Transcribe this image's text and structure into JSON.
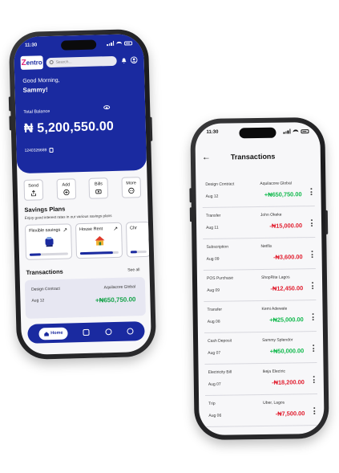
{
  "home": {
    "status_time": "11:30",
    "logo_initial": "Z",
    "logo_rest": "entro",
    "search_placeholder": "Search...",
    "greeting": "Good Morning,",
    "user_name": "Sammy!",
    "total_balance_label": "Total Balance",
    "balance": "₦ 5,200,550.00",
    "account_number": "1240326689",
    "actions": [
      {
        "label": "Send",
        "icon": "share-icon"
      },
      {
        "label": "Add",
        "icon": "plus-circle-icon"
      },
      {
        "label": "Bills",
        "icon": "bill-icon"
      },
      {
        "label": "More",
        "icon": "more-icon"
      }
    ],
    "savings_title": "Savings Plans",
    "savings_subtitle": "Enjoy good interest rates in our various savings plans",
    "plans": [
      {
        "label": "Flexible savings",
        "progress": 0.3
      },
      {
        "label": "House Rent",
        "progress": 0.85
      },
      {
        "label": "Chr",
        "progress": 0.4
      }
    ],
    "transactions_title": "Transactions",
    "see_all": "See all",
    "latest_tx": {
      "desc": "Design Contract",
      "date": "Aug 12",
      "counterparty": "Aquilacore Global",
      "amount": "+₦650,750.00"
    },
    "nav": {
      "home_label": "Home"
    }
  },
  "transactions": {
    "status_time": "11:30",
    "title": "Transactions",
    "items": [
      {
        "desc": "Design Contract",
        "date": "Aug 12",
        "counterparty": "Aquilacore Global",
        "amount": "+₦650,750.00",
        "kind": "credit"
      },
      {
        "desc": "Transfer",
        "date": "Aug 11",
        "counterparty": "John Okeke",
        "amount": "-₦15,000.00",
        "kind": "debit"
      },
      {
        "desc": "Subscription",
        "date": "Aug 09",
        "counterparty": "Netflix",
        "amount": "-₦3,600.00",
        "kind": "debit"
      },
      {
        "desc": "POS Purchase",
        "date": "Aug 09",
        "counterparty": "ShopRite Lagos",
        "amount": "-₦12,450.00",
        "kind": "debit"
      },
      {
        "desc": "Transfer",
        "date": "Aug 08",
        "counterparty": "Kemi Adewale",
        "amount": "+₦25,000.00",
        "kind": "credit"
      },
      {
        "desc": "Cash Deposit",
        "date": "Aug 07",
        "counterparty": "Sammy Splendor",
        "amount": "+₦50,000.00",
        "kind": "credit"
      },
      {
        "desc": "Electricity Bill",
        "date": "Aug 07",
        "counterparty": "Ikeja Electric",
        "amount": "-₦18,200.00",
        "kind": "debit"
      },
      {
        "desc": "Trip",
        "date": "Aug 06",
        "counterparty": "Uber, Lagos",
        "amount": "-₦7,500.00",
        "kind": "debit"
      }
    ]
  },
  "colors": {
    "brand": "#1a2aa0",
    "credit": "#10b94c",
    "debit": "#e11d2e"
  }
}
